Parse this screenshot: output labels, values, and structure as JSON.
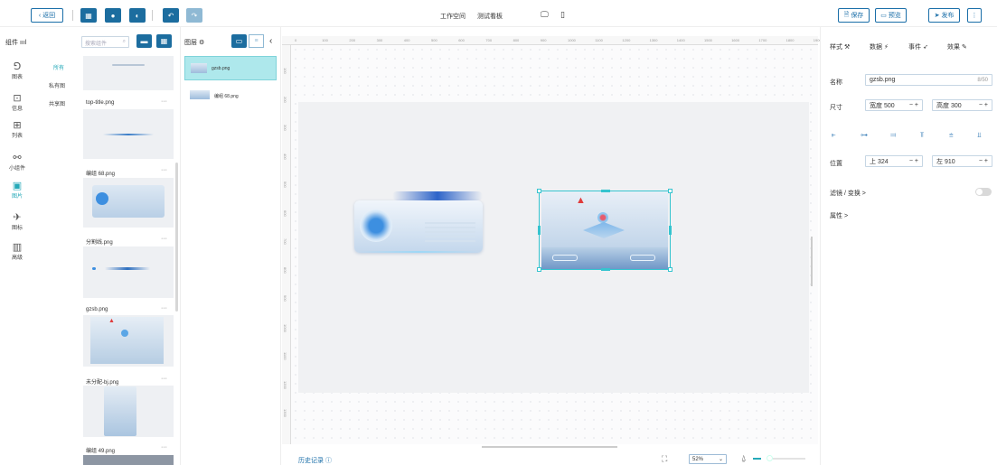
{
  "toolbar": {
    "back_label": "返回",
    "breadcrumb_workspace": "工作空间",
    "breadcrumb_board": "测试看板",
    "save_label": "保存",
    "preview_label": "预览",
    "publish_label": "发布",
    "more_label": "⋮"
  },
  "components_panel": {
    "title": "组件",
    "search_placeholder": "搜索组件",
    "rail": [
      {
        "label": "图表",
        "icon": "chart-icon"
      },
      {
        "label": "信息",
        "icon": "info-icon"
      },
      {
        "label": "列表",
        "icon": "list-icon"
      },
      {
        "label": "小组件",
        "icon": "widget-icon"
      },
      {
        "label": "图片",
        "icon": "image-icon"
      },
      {
        "label": "图标",
        "icon": "icon-icon"
      },
      {
        "label": "高级",
        "icon": "advanced-icon"
      }
    ],
    "subtabs": [
      "所有",
      "私有图",
      "共享图"
    ],
    "assets": [
      {
        "name": "top-title.png"
      },
      {
        "name": "编组 68.png"
      },
      {
        "name": "分割线.png"
      },
      {
        "name": "gzsb.png"
      },
      {
        "name": "未分配-bj.png"
      },
      {
        "name": "编组 49.png"
      }
    ]
  },
  "layers_panel": {
    "title": "图层",
    "layers": [
      {
        "name": "gzsb.png",
        "selected": true
      },
      {
        "name": "编组 68.png",
        "selected": false
      }
    ]
  },
  "ruler": {
    "h_ticks": [
      "0",
      "100",
      "200",
      "300",
      "400",
      "500",
      "600",
      "700",
      "800",
      "900",
      "1000",
      "1100",
      "1200",
      "1300",
      "1400",
      "1500",
      "1600",
      "1700",
      "1800",
      "1900"
    ],
    "v_ticks": [
      "100",
      "200",
      "300",
      "400",
      "500",
      "600",
      "700",
      "800",
      "900",
      "1000",
      "1100",
      "1200",
      "1300"
    ]
  },
  "bottom": {
    "history_label": "历史记录",
    "zoom": "52%"
  },
  "props": {
    "tabs": [
      "样式",
      "数据",
      "事件",
      "效果"
    ],
    "name_label": "名称",
    "name_value": "gzsb.png",
    "name_count": "8/50",
    "size_label": "尺寸",
    "width_value": "宽度 500",
    "height_value": "高度 300",
    "pos_label": "位置",
    "top_value": "上 324",
    "left_value": "左 910",
    "filter_label": "滤镜 / 变换 >",
    "attr_label": "属性 >",
    "accent": "#25a9b8",
    "primary": "#1c6d9f"
  }
}
